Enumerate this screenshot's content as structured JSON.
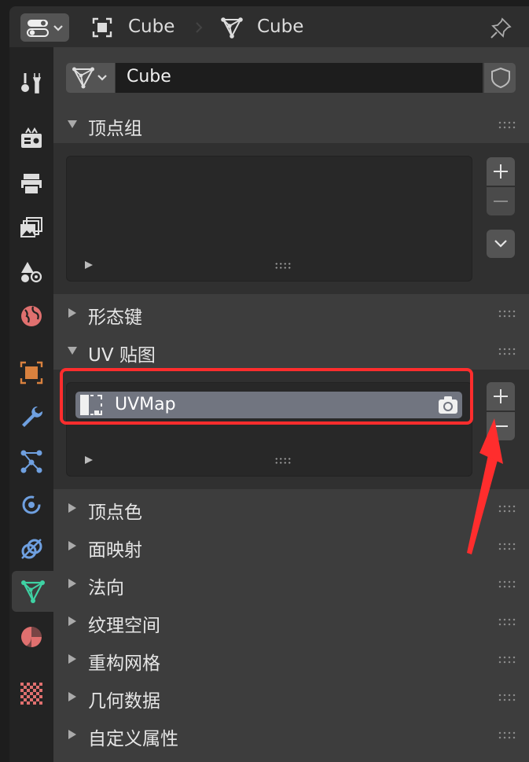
{
  "header": {
    "object_name": "Cube",
    "mesh_name": "Cube"
  },
  "datablock": {
    "name_value": "Cube"
  },
  "sections": {
    "vertex_groups": "顶点组",
    "shape_keys": "形态键",
    "uv_maps": "UV 贴图",
    "vertex_colors": "顶点色",
    "face_maps": "面映射",
    "normals": "法向",
    "texture_space": "纹理空间",
    "remesh": "重构网格",
    "geometry_data": "几何数据",
    "custom_props": "自定义属性"
  },
  "uv_list": {
    "items": [
      {
        "name": "UVMap"
      }
    ]
  },
  "colors": {
    "highlight_box": "#ff2d2d",
    "active_tab_icon": "#3fd2a4",
    "object_tab": "#d9813e",
    "selected_row": "#717580"
  },
  "icons": {
    "editor_type": "properties-editor-icon",
    "object": "object-icon",
    "mesh": "mesh-data-icon",
    "pin": "pin-icon",
    "fake_user": "shield-icon",
    "uv_item": "uv-map-icon",
    "active_render": "camera-icon"
  }
}
